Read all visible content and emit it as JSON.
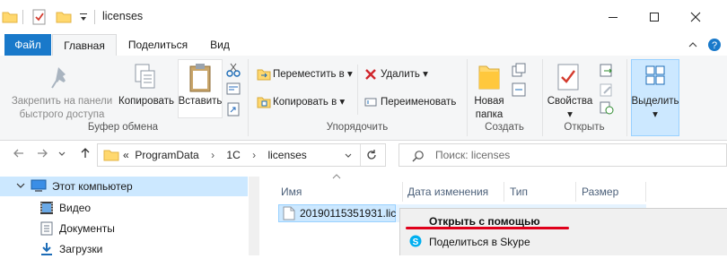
{
  "window": {
    "title": "licenses",
    "minimize": "—",
    "maximize": "☐",
    "close": "✕"
  },
  "ribbon_tabs": [
    "Файл",
    "Главная",
    "Поделиться",
    "Вид"
  ],
  "clipboard": {
    "pin": "Закрепить на панели быстрого доступа",
    "pin_line1": "Закрепить на панели",
    "pin_line2": "быстрого доступа",
    "copy": "Копировать",
    "paste": "Вставить",
    "group": "Буфер обмена"
  },
  "organize": {
    "move": "Переместить в",
    "copy_to": "Копировать в",
    "delete": "Удалить",
    "rename": "Переименовать",
    "group": "Упорядочить"
  },
  "create": {
    "new_folder_l1": "Новая",
    "new_folder_l2": "папка",
    "group": "Создать"
  },
  "open": {
    "properties": "Свойства",
    "group": "Открыть"
  },
  "select": {
    "label": "Выделить"
  },
  "address": {
    "prefix": "«",
    "crumbs": [
      "ProgramData",
      "1C",
      "licenses"
    ],
    "sep": "›"
  },
  "search": {
    "placeholder": "Поиск: licenses"
  },
  "nav": [
    "Этот компьютер",
    "Видео",
    "Документы",
    "Загрузки"
  ],
  "columns": [
    "Имя",
    "Дата изменения",
    "Тип",
    "Размер"
  ],
  "files": [
    {
      "name": "20190115351931.lic"
    }
  ],
  "context_menu": [
    "Открыть с помощью",
    "Поделиться в Skype"
  ],
  "colors": {
    "accent": "#1979ca",
    "underline": "#e0001b",
    "selection": "#cce8ff"
  }
}
